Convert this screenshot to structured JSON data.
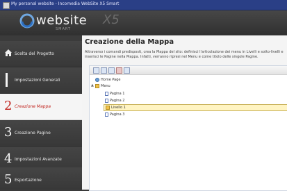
{
  "window": {
    "title": "My personal website - Incomedia WebSite X5 Smart"
  },
  "brand": {
    "name": "website",
    "version": "X5",
    "edition": "SMART"
  },
  "sidebar": {
    "items": [
      {
        "number": "",
        "label": "Scelta del Progetto",
        "icon": "home-icon"
      },
      {
        "number": "",
        "label": "Impostazioni Generali",
        "icon": "bar-icon"
      },
      {
        "number": "2",
        "label": "Creazione Mappa",
        "active": true
      },
      {
        "number": "3",
        "label": "Creazione Pagine"
      },
      {
        "number": "4",
        "label": "Impostazioni Avanzate"
      },
      {
        "number": "5",
        "label": "Esportazione"
      }
    ]
  },
  "main": {
    "title": "Creazione della Mappa",
    "description": "Attraverso i comandi predisposti, crea la Mappa del sito: definisci l'articolazione dei menu in Livelli e sotto-livelli e inserisci le Pagine nella Mappa. Infatti, verranno ripresi nel Menu e come titolo delle singole Pagine.",
    "toolbar_icons": [
      "new-level-icon",
      "new-page-icon",
      "rename-icon",
      "delete-icon",
      "move-icon"
    ],
    "tree": [
      {
        "label": "Home Page",
        "type": "home",
        "depth": 0
      },
      {
        "label": "Menu",
        "type": "folder",
        "depth": 0,
        "expanded": true
      },
      {
        "label": "Pagina 1",
        "type": "page",
        "depth": 1
      },
      {
        "label": "Pagina 2",
        "type": "page",
        "depth": 1
      },
      {
        "label": "Livello 1",
        "type": "folder",
        "depth": 1,
        "selected": true
      },
      {
        "label": "Pagina 3",
        "type": "page",
        "depth": 1
      }
    ]
  },
  "colors": {
    "active": "#c0201a",
    "title_bar": "#2a3f86",
    "selection": "#fff4c2"
  }
}
